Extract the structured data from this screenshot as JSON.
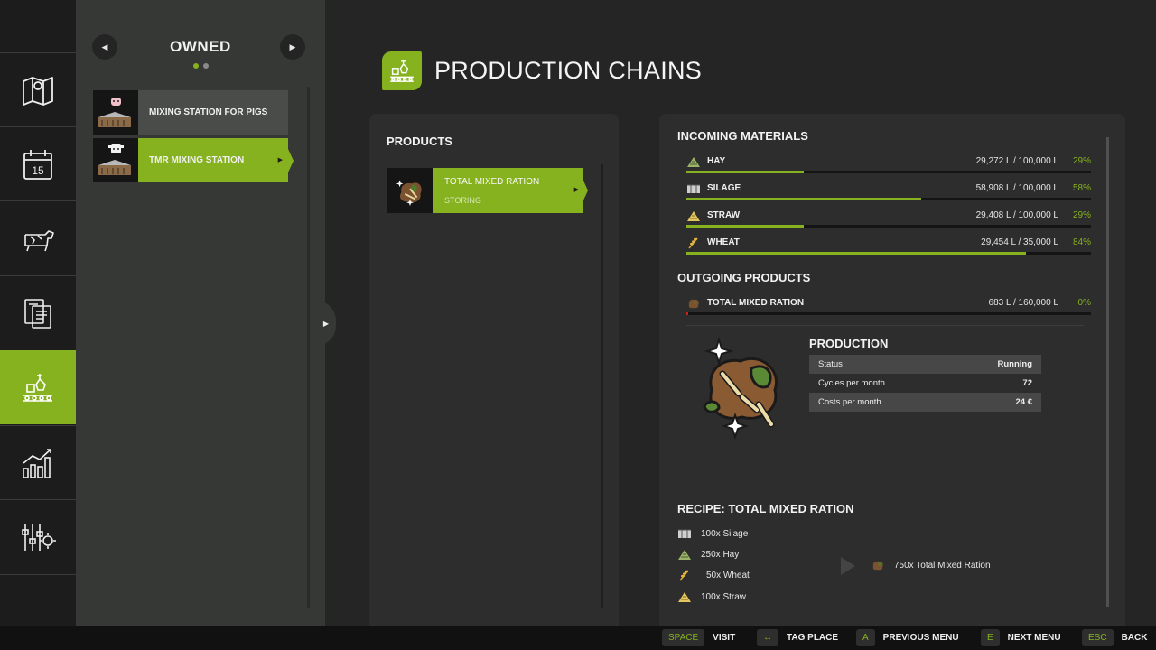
{
  "nav": {
    "items": [
      {
        "icon": "map-icon"
      },
      {
        "icon": "calendar-icon",
        "text": "15"
      },
      {
        "icon": "cow-icon"
      },
      {
        "icon": "contracts-icon"
      },
      {
        "icon": "production-icon"
      },
      {
        "icon": "statistics-icon"
      },
      {
        "icon": "settings-icon"
      }
    ],
    "active_index": 4
  },
  "owned": {
    "title": "OWNED",
    "items": [
      {
        "label": "MIXING STATION FOR PIGS"
      },
      {
        "label": "TMR MIXING STATION"
      }
    ]
  },
  "page": {
    "title": "PRODUCTION CHAINS"
  },
  "products": {
    "heading": "PRODUCTS",
    "items": [
      {
        "name": "TOTAL MIXED RATION",
        "status": "STORING"
      }
    ]
  },
  "incoming": {
    "heading": "INCOMING MATERIALS",
    "items": [
      {
        "name": "HAY",
        "amount": "29,272 L / 100,000 L",
        "percent": "29%",
        "fill": 0.29,
        "icon": "hay-icon"
      },
      {
        "name": "SILAGE",
        "amount": "58,908 L / 100,000 L",
        "percent": "58%",
        "fill": 0.58,
        "icon": "silage-icon"
      },
      {
        "name": "STRAW",
        "amount": "29,408 L / 100,000 L",
        "percent": "29%",
        "fill": 0.29,
        "icon": "straw-icon"
      },
      {
        "name": "WHEAT",
        "amount": "29,454 L / 35,000 L",
        "percent": "84%",
        "fill": 0.84,
        "icon": "wheat-icon"
      }
    ]
  },
  "outgoing": {
    "heading": "OUTGOING PRODUCTS",
    "items": [
      {
        "name": "TOTAL MIXED RATION",
        "amount": "683 L / 160,000 L",
        "percent": "0%",
        "fill": 0.005,
        "icon": "tmr-icon"
      }
    ]
  },
  "production": {
    "heading": "PRODUCTION",
    "rows": [
      {
        "label": "Status",
        "value": "Running"
      },
      {
        "label": "Cycles per month",
        "value": "72"
      },
      {
        "label": "Costs per month",
        "value": "24 €"
      }
    ]
  },
  "recipe": {
    "heading": "RECIPE: TOTAL MIXED RATION",
    "inputs": [
      {
        "text": "100x Silage",
        "icon": "silage-icon"
      },
      {
        "text": "250x Hay",
        "icon": "hay-icon"
      },
      {
        "text": "50x Wheat",
        "icon": "wheat-icon"
      },
      {
        "text": "100x Straw",
        "icon": "straw-icon"
      }
    ],
    "output": {
      "text": "750x Total Mixed Ration",
      "icon": "tmr-icon"
    }
  },
  "footer": {
    "hints": [
      {
        "key": "SPACE",
        "label": "VISIT"
      },
      {
        "key": "↔",
        "label": "TAG PLACE"
      },
      {
        "key": "A",
        "label": "PREVIOUS MENU"
      },
      {
        "key": "E",
        "label": "NEXT MENU"
      },
      {
        "key": "ESC",
        "label": "BACK"
      }
    ]
  },
  "colors": {
    "accent": "#86b21f",
    "warning": "#c8231e",
    "panel": "#2d2d2d",
    "sidebar": "#363836"
  }
}
